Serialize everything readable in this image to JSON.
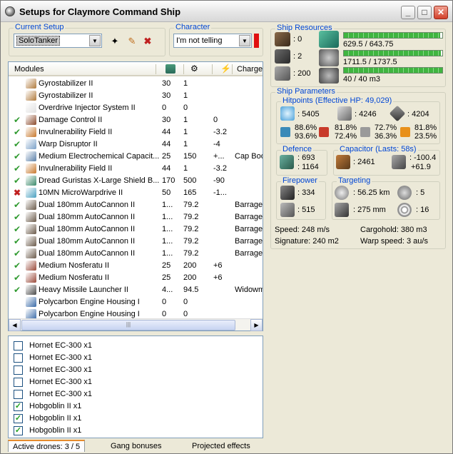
{
  "window": {
    "title": "Setups for Claymore Command Ship"
  },
  "setup": {
    "label": "Current Setup",
    "value": "SoloTanker"
  },
  "character": {
    "label": "Character",
    "value": "I'm not telling"
  },
  "modules": {
    "headers": {
      "name": "Modules",
      "charges": "Charges"
    },
    "rows": [
      {
        "state": "",
        "name": "Gyrostabilizer II",
        "c1": "30",
        "c2": "1",
        "c3": "",
        "charge": "",
        "color": "#b07a3c"
      },
      {
        "state": "",
        "name": "Gyrostabilizer II",
        "c1": "30",
        "c2": "1",
        "c3": "",
        "charge": "",
        "color": "#b07a3c"
      },
      {
        "state": "",
        "name": "Overdrive Injector System II",
        "c1": "0",
        "c2": "0",
        "c3": "",
        "charge": "",
        "color": "#e0e0e0"
      },
      {
        "state": "on",
        "name": "Damage Control II",
        "c1": "30",
        "c2": "1",
        "c3": "0",
        "charge": "",
        "color": "#8b4a2b"
      },
      {
        "state": "on",
        "name": "Invulnerability Field II",
        "c1": "44",
        "c2": "1",
        "c3": "-3.2",
        "charge": "",
        "color": "#c8782c"
      },
      {
        "state": "on",
        "name": "Warp Disruptor II",
        "c1": "44",
        "c2": "1",
        "c3": "-4",
        "charge": "",
        "color": "#7aa0c8"
      },
      {
        "state": "on",
        "name": "Medium Electrochemical Capacit...",
        "c1": "25",
        "c2": "150",
        "c3": "+...",
        "charge": "Cap Boo",
        "color": "#5a7fa8"
      },
      {
        "state": "on",
        "name": "Invulnerability Field II",
        "c1": "44",
        "c2": "1",
        "c3": "-3.2",
        "charge": "",
        "color": "#c8782c"
      },
      {
        "state": "on",
        "name": "Dread Guristas X-Large Shield B...",
        "c1": "170",
        "c2": "500",
        "c3": "-90",
        "charge": "",
        "color": "#3a8a6a"
      },
      {
        "state": "off",
        "name": "10MN MicroWarpdrive II",
        "c1": "50",
        "c2": "165",
        "c3": "-1...",
        "charge": "",
        "color": "#4aa0c0"
      },
      {
        "state": "on",
        "name": "Dual 180mm AutoCannon II",
        "c1": "1...",
        "c2": "79.2",
        "c3": "",
        "charge": "Barrage",
        "color": "#6a5a4a"
      },
      {
        "state": "on",
        "name": "Dual 180mm AutoCannon II",
        "c1": "1...",
        "c2": "79.2",
        "c3": "",
        "charge": "Barrage",
        "color": "#6a5a4a"
      },
      {
        "state": "on",
        "name": "Dual 180mm AutoCannon II",
        "c1": "1...",
        "c2": "79.2",
        "c3": "",
        "charge": "Barrage",
        "color": "#6a5a4a"
      },
      {
        "state": "on",
        "name": "Dual 180mm AutoCannon II",
        "c1": "1...",
        "c2": "79.2",
        "c3": "",
        "charge": "Barrage",
        "color": "#6a5a4a"
      },
      {
        "state": "on",
        "name": "Dual 180mm AutoCannon II",
        "c1": "1...",
        "c2": "79.2",
        "c3": "",
        "charge": "Barrage",
        "color": "#6a5a4a"
      },
      {
        "state": "on",
        "name": "Medium Nosferatu II",
        "c1": "25",
        "c2": "200",
        "c3": "+6",
        "charge": "",
        "color": "#9a4a3a"
      },
      {
        "state": "on",
        "name": "Medium Nosferatu II",
        "c1": "25",
        "c2": "200",
        "c3": "+6",
        "charge": "",
        "color": "#9a4a3a"
      },
      {
        "state": "on",
        "name": "Heavy Missile Launcher II",
        "c1": "4...",
        "c2": "94.5",
        "c3": "",
        "charge": "Widowm",
        "color": "#4a4a4a"
      },
      {
        "state": "",
        "name": "Polycarbon Engine Housing I",
        "c1": "0",
        "c2": "0",
        "c3": "",
        "charge": "",
        "color": "#3a6aa8"
      },
      {
        "state": "",
        "name": "Polycarbon Engine Housing I",
        "c1": "0",
        "c2": "0",
        "c3": "",
        "charge": "",
        "color": "#3a6aa8"
      }
    ]
  },
  "drones": [
    {
      "label": "Hornet EC-300 x1",
      "checked": false
    },
    {
      "label": "Hornet EC-300 x1",
      "checked": false
    },
    {
      "label": "Hornet EC-300 x1",
      "checked": false
    },
    {
      "label": "Hornet EC-300 x1",
      "checked": false
    },
    {
      "label": "Hornet EC-300 x1",
      "checked": false
    },
    {
      "label": "Hobgoblin II x1",
      "checked": true
    },
    {
      "label": "Hobgoblin II x1",
      "checked": true
    },
    {
      "label": "Hobgoblin II x1",
      "checked": true
    }
  ],
  "tabs": [
    "Active drones: 3 / 5",
    "Gang bonuses",
    "Projected effects"
  ],
  "resources": {
    "label": "Ship Resources",
    "slots": [
      ": 0",
      ": 2",
      ": 200"
    ],
    "bars": [
      {
        "text": "629.5 / 643.75",
        "fraction": 0.978
      },
      {
        "text": "1711.5 / 1737.5",
        "fraction": 0.985
      },
      {
        "text": "40 / 40 m3",
        "fraction": 1.0
      }
    ]
  },
  "params": {
    "label": "Ship Parameters",
    "hitpoints": {
      "label": "Hitpoints (Effective HP: 49,029)",
      "shield": ": 5405",
      "armor": ": 4246",
      "structure": ": 4204",
      "resists": [
        [
          "88.6%",
          "93.6%"
        ],
        [
          "81.8%",
          "72.4%"
        ],
        [
          "72.7%",
          "36.3%"
        ],
        [
          "81.8%",
          "23.5%"
        ]
      ]
    },
    "defence": {
      "label": "Defence",
      "v1": ": 693",
      "v2": ": 1164"
    },
    "capacitor": {
      "label": "Capacitor (Lasts: 58s)",
      "v": ": 2461",
      "d1": ": -100.4",
      "d2": "+61.9"
    },
    "firepower": {
      "label": "Firepower",
      "v1": ": 334",
      "v2": ": 515"
    },
    "targeting": {
      "label": "Targeting",
      "range": ": 56.25 km",
      "targets": ": 5",
      "scan": ": 275 mm",
      "sensor": ": 16"
    },
    "speed": "Speed: 248 m/s",
    "cargohold": "Cargohold: 380 m3",
    "signature": "Signature: 240 m2",
    "warp": "Warp speed: 3 au/s"
  }
}
